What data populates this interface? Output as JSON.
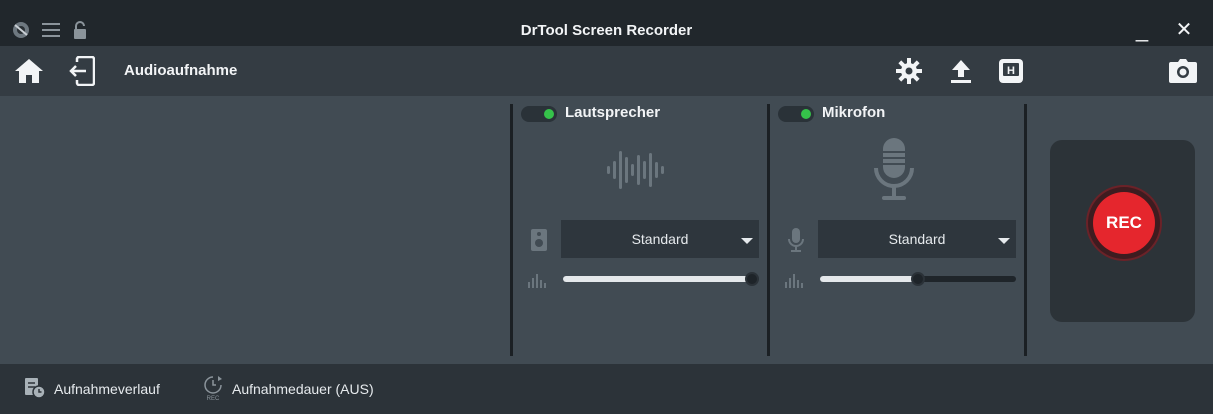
{
  "window": {
    "title": "DrTool Screen Recorder",
    "minimize_label": "_",
    "close_label": "✕"
  },
  "toolbar": {
    "page_title": "Audioaufnahme"
  },
  "speaker": {
    "label": "Lautsprecher",
    "enabled": true,
    "device": "Standard",
    "volume_level": 1.0
  },
  "microphone": {
    "label": "Mikrofon",
    "enabled": true,
    "device": "Standard",
    "volume_level": 0.5
  },
  "record": {
    "label": "REC"
  },
  "status": {
    "history_label": "Aufnahmeverlauf",
    "duration_label": "Aufnahmedauer (AUS)"
  },
  "colors": {
    "toggle_on": "#35c24a",
    "rec": "#e5262d"
  }
}
